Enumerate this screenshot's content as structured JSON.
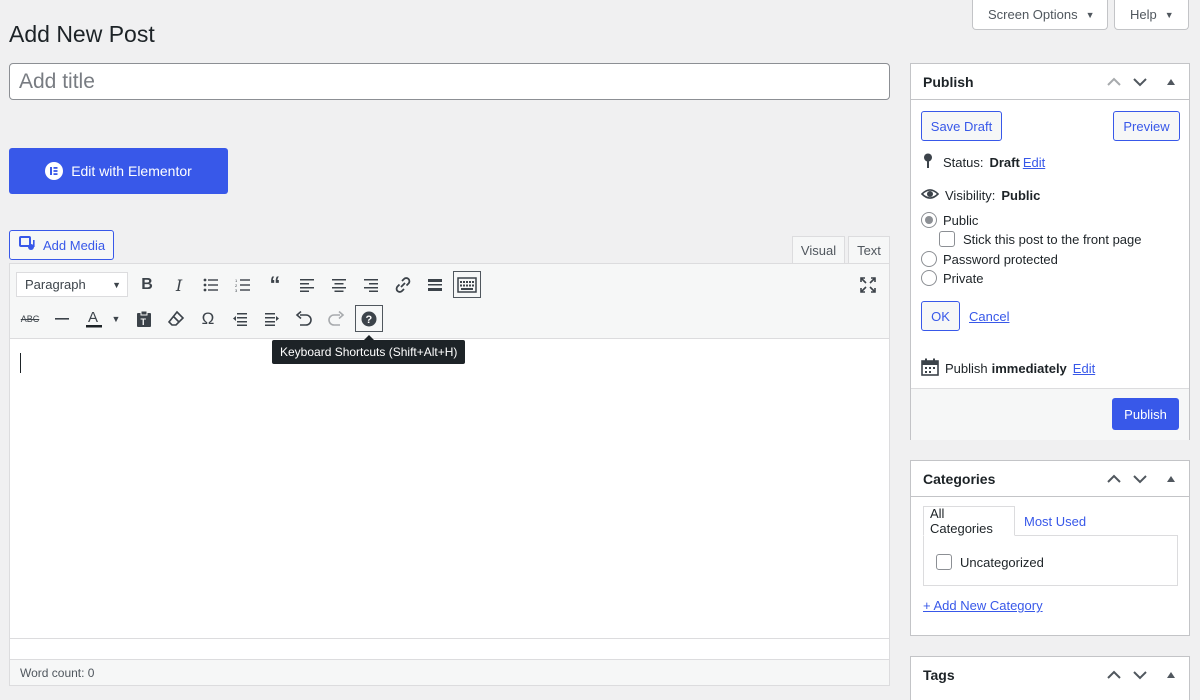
{
  "header": {
    "screen_options_label": "Screen Options",
    "help_label": "Help",
    "page_title": "Add New Post"
  },
  "title_field": {
    "placeholder": "Add title",
    "value": ""
  },
  "elementor": {
    "button_label": "Edit with Elementor"
  },
  "editor": {
    "add_media_label": "Add Media",
    "tabs": [
      "Visual",
      "Text"
    ],
    "active_tab": "Visual",
    "format_select": "Paragraph",
    "toolbar_row1_icons": [
      "bold-icon",
      "italic-icon",
      "bullet-list-icon",
      "numbered-list-icon",
      "blockquote-icon",
      "align-left-icon",
      "align-center-icon",
      "align-right-icon",
      "link-icon",
      "read-more-icon",
      "toolbar-toggle-icon",
      "fullscreen-icon"
    ],
    "toolbar_row2_icons": [
      "strikethrough-icon",
      "horizontal-line-icon",
      "text-color-icon",
      "paste-text-icon",
      "clear-formatting-icon",
      "special-character-icon",
      "outdent-icon",
      "indent-icon",
      "undo-icon",
      "redo-icon",
      "keyboard-shortcuts-icon"
    ],
    "tooltip": "Keyboard Shortcuts (Shift+Alt+H)",
    "word_count": "Word count: 0"
  },
  "publish": {
    "title": "Publish",
    "save_draft_label": "Save Draft",
    "preview_label": "Preview",
    "status_label": "Status:",
    "status_value": "Draft",
    "status_edit": "Edit",
    "visibility_label": "Visibility:",
    "visibility_value": "Public",
    "visibility_options": [
      "Public",
      "Password protected",
      "Private"
    ],
    "selected_visibility": "Public",
    "sticky_label": "Stick this post to the front page",
    "ok_label": "OK",
    "cancel_label": "Cancel",
    "publish_time_label": "Publish",
    "publish_time_value": "immediately",
    "publish_time_edit": "Edit",
    "publish_button": "Publish"
  },
  "categories": {
    "title": "Categories",
    "tabs": [
      "All Categories",
      "Most Used"
    ],
    "items": [
      "Uncategorized"
    ],
    "add_new_label": "+ Add New Category"
  },
  "tags": {
    "title": "Tags"
  },
  "colors": {
    "accent": "#3858e9",
    "background": "#f0f0f1",
    "tooltip_bg": "#1d2327"
  }
}
